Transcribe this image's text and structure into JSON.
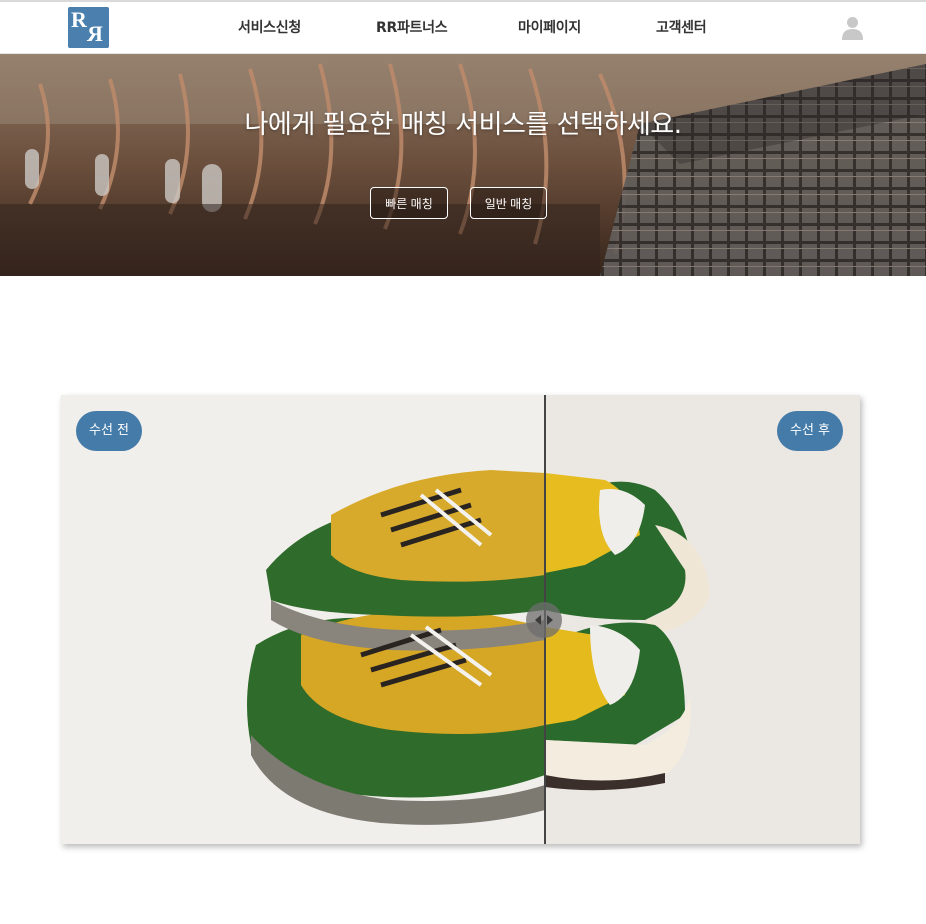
{
  "header": {
    "logo_alt": "RR",
    "nav": [
      {
        "label": "서비스신청"
      },
      {
        "label": "RR파트너스"
      },
      {
        "label": "마이페이지"
      },
      {
        "label": "고객센터"
      }
    ],
    "user_icon": "user-icon"
  },
  "hero": {
    "title": "나에게 필요한 매칭 서비스를 선택하세요.",
    "buttons": [
      {
        "label": "빠른 매칭"
      },
      {
        "label": "일반 매칭"
      }
    ]
  },
  "compare": {
    "before_label": "수선 전",
    "after_label": "수선 후",
    "handle_icon": "left-right-arrows-icon",
    "split_fraction": 0.605
  },
  "colors": {
    "accent": "#4a7fae",
    "badge": "#447ba8"
  }
}
